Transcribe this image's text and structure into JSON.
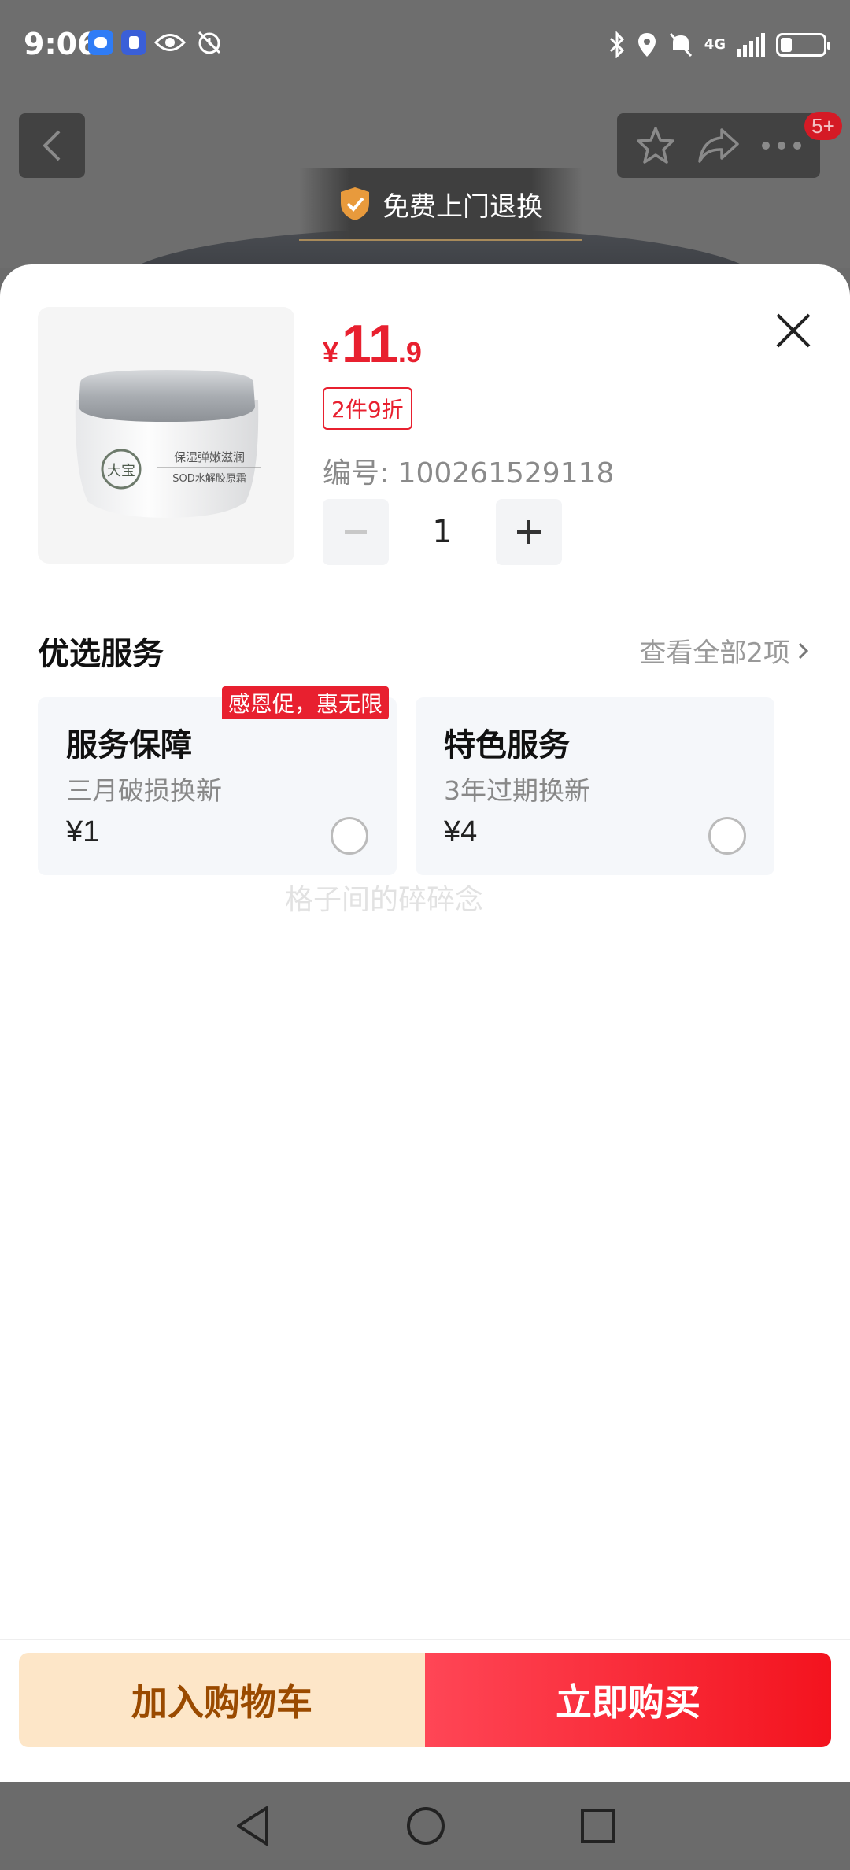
{
  "status_bar": {
    "time": "9:06",
    "network": "4G"
  },
  "background_page": {
    "cart_badge": "5+",
    "return_banner": "免费上门退换"
  },
  "product": {
    "price_symbol": "¥",
    "price_integer": "11",
    "price_decimal": ".9",
    "discount_tag": "2件9折",
    "sku_label": "编号: 100261529118",
    "quantity": "1",
    "image_text_line1": "保湿弹嫩滋润",
    "image_text_line2": "SOD水解胶原霜",
    "image_logo_text": "大宝"
  },
  "services": {
    "title": "优选服务",
    "view_all": "查看全部2项",
    "items": [
      {
        "name": "服务保障",
        "desc": "三月破损换新",
        "price": "¥1",
        "badge": "感恩促，惠无限",
        "selected": false
      },
      {
        "name": "特色服务",
        "desc": "3年过期换新",
        "price": "¥4",
        "badge": "",
        "selected": false
      }
    ]
  },
  "watermark": "格子间的碎碎念",
  "actions": {
    "add_to_cart": "加入购物车",
    "buy_now": "立即购买"
  },
  "colors": {
    "accent_red": "#e8202f",
    "cart_button_bg": "#fde6c8",
    "cart_button_text": "#9a4a00"
  }
}
